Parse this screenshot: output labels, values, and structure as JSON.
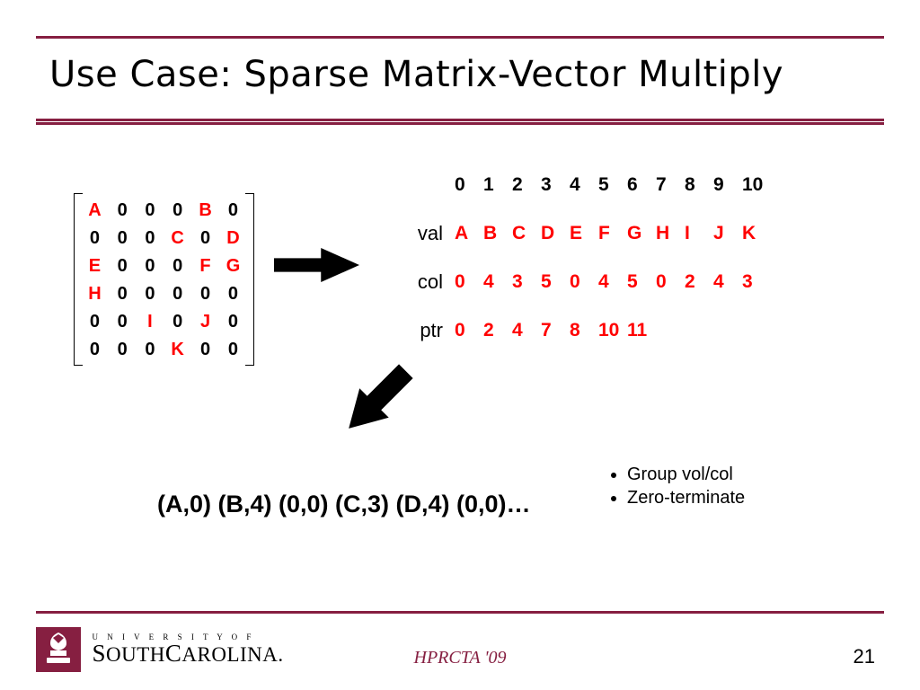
{
  "title": "Use Case:  Sparse Matrix-Vector Multiply",
  "matrix": {
    "rows": [
      [
        {
          "v": "A",
          "nz": true
        },
        {
          "v": "0"
        },
        {
          "v": "0"
        },
        {
          "v": "0"
        },
        {
          "v": "B",
          "nz": true
        },
        {
          "v": "0"
        }
      ],
      [
        {
          "v": "0"
        },
        {
          "v": "0"
        },
        {
          "v": "0"
        },
        {
          "v": "C",
          "nz": true
        },
        {
          "v": "0"
        },
        {
          "v": "D",
          "nz": true
        }
      ],
      [
        {
          "v": "E",
          "nz": true
        },
        {
          "v": "0"
        },
        {
          "v": "0"
        },
        {
          "v": "0"
        },
        {
          "v": "F",
          "nz": true
        },
        {
          "v": "G",
          "nz": true
        }
      ],
      [
        {
          "v": "H",
          "nz": true
        },
        {
          "v": "0"
        },
        {
          "v": "0"
        },
        {
          "v": "0"
        },
        {
          "v": "0"
        },
        {
          "v": "0"
        }
      ],
      [
        {
          "v": "0"
        },
        {
          "v": "0"
        },
        {
          "v": "I",
          "nz": true
        },
        {
          "v": "0"
        },
        {
          "v": "J",
          "nz": true
        },
        {
          "v": "0"
        }
      ],
      [
        {
          "v": "0"
        },
        {
          "v": "0"
        },
        {
          "v": "0"
        },
        {
          "v": "K",
          "nz": true
        },
        {
          "v": "0"
        },
        {
          "v": "0"
        }
      ]
    ]
  },
  "csr": {
    "idx": [
      "0",
      "1",
      "2",
      "3",
      "4",
      "5",
      "6",
      "7",
      "8",
      "9",
      "10"
    ],
    "val_label": "val",
    "val": [
      "A",
      "B",
      "C",
      "D",
      "E",
      "F",
      "G",
      "H",
      "I",
      "J",
      "K"
    ],
    "col_label": "col",
    "col": [
      "0",
      "4",
      "3",
      "5",
      "0",
      "4",
      "5",
      "0",
      "2",
      "4",
      "3"
    ],
    "ptr_label": "ptr",
    "ptr": [
      "0",
      "2",
      "4",
      "7",
      "8",
      "10",
      "11"
    ]
  },
  "tuples": "(A,0) (B,4) (0,0) (C,3) (D,4) (0,0)…",
  "bullets": [
    "Group vol/col",
    "Zero-terminate"
  ],
  "footer": {
    "conf": "HPRCTA '09",
    "page": "21",
    "univ_line1": "U N I V E R S I T Y  O F",
    "univ_line2_a": "S",
    "univ_line2_b": "OUTH",
    "univ_line2_c": "C",
    "univ_line2_d": "AROLINA",
    "univ_dot": "."
  }
}
